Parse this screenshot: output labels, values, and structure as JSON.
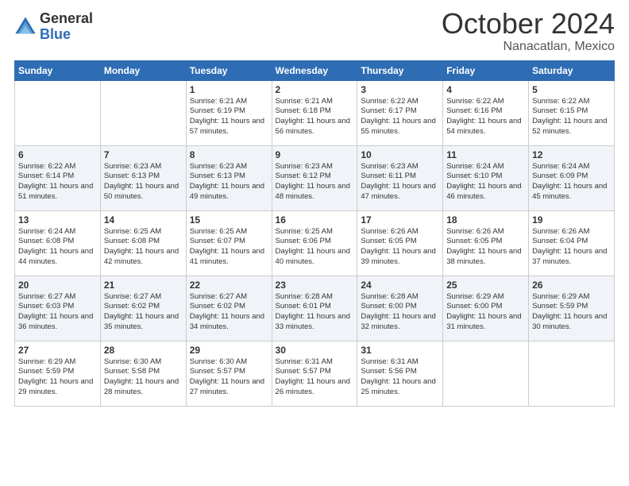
{
  "logo": {
    "general": "General",
    "blue": "Blue"
  },
  "title": {
    "month": "October 2024",
    "location": "Nanacatlan, Mexico"
  },
  "days_of_week": [
    "Sunday",
    "Monday",
    "Tuesday",
    "Wednesday",
    "Thursday",
    "Friday",
    "Saturday"
  ],
  "weeks": [
    [
      {
        "day": "",
        "info": ""
      },
      {
        "day": "",
        "info": ""
      },
      {
        "day": "1",
        "info": "Sunrise: 6:21 AM\nSunset: 6:19 PM\nDaylight: 11 hours and 57 minutes."
      },
      {
        "day": "2",
        "info": "Sunrise: 6:21 AM\nSunset: 6:18 PM\nDaylight: 11 hours and 56 minutes."
      },
      {
        "day": "3",
        "info": "Sunrise: 6:22 AM\nSunset: 6:17 PM\nDaylight: 11 hours and 55 minutes."
      },
      {
        "day": "4",
        "info": "Sunrise: 6:22 AM\nSunset: 6:16 PM\nDaylight: 11 hours and 54 minutes."
      },
      {
        "day": "5",
        "info": "Sunrise: 6:22 AM\nSunset: 6:15 PM\nDaylight: 11 hours and 52 minutes."
      }
    ],
    [
      {
        "day": "6",
        "info": "Sunrise: 6:22 AM\nSunset: 6:14 PM\nDaylight: 11 hours and 51 minutes."
      },
      {
        "day": "7",
        "info": "Sunrise: 6:23 AM\nSunset: 6:13 PM\nDaylight: 11 hours and 50 minutes."
      },
      {
        "day": "8",
        "info": "Sunrise: 6:23 AM\nSunset: 6:13 PM\nDaylight: 11 hours and 49 minutes."
      },
      {
        "day": "9",
        "info": "Sunrise: 6:23 AM\nSunset: 6:12 PM\nDaylight: 11 hours and 48 minutes."
      },
      {
        "day": "10",
        "info": "Sunrise: 6:23 AM\nSunset: 6:11 PM\nDaylight: 11 hours and 47 minutes."
      },
      {
        "day": "11",
        "info": "Sunrise: 6:24 AM\nSunset: 6:10 PM\nDaylight: 11 hours and 46 minutes."
      },
      {
        "day": "12",
        "info": "Sunrise: 6:24 AM\nSunset: 6:09 PM\nDaylight: 11 hours and 45 minutes."
      }
    ],
    [
      {
        "day": "13",
        "info": "Sunrise: 6:24 AM\nSunset: 6:08 PM\nDaylight: 11 hours and 44 minutes."
      },
      {
        "day": "14",
        "info": "Sunrise: 6:25 AM\nSunset: 6:08 PM\nDaylight: 11 hours and 42 minutes."
      },
      {
        "day": "15",
        "info": "Sunrise: 6:25 AM\nSunset: 6:07 PM\nDaylight: 11 hours and 41 minutes."
      },
      {
        "day": "16",
        "info": "Sunrise: 6:25 AM\nSunset: 6:06 PM\nDaylight: 11 hours and 40 minutes."
      },
      {
        "day": "17",
        "info": "Sunrise: 6:26 AM\nSunset: 6:05 PM\nDaylight: 11 hours and 39 minutes."
      },
      {
        "day": "18",
        "info": "Sunrise: 6:26 AM\nSunset: 6:05 PM\nDaylight: 11 hours and 38 minutes."
      },
      {
        "day": "19",
        "info": "Sunrise: 6:26 AM\nSunset: 6:04 PM\nDaylight: 11 hours and 37 minutes."
      }
    ],
    [
      {
        "day": "20",
        "info": "Sunrise: 6:27 AM\nSunset: 6:03 PM\nDaylight: 11 hours and 36 minutes."
      },
      {
        "day": "21",
        "info": "Sunrise: 6:27 AM\nSunset: 6:02 PM\nDaylight: 11 hours and 35 minutes."
      },
      {
        "day": "22",
        "info": "Sunrise: 6:27 AM\nSunset: 6:02 PM\nDaylight: 11 hours and 34 minutes."
      },
      {
        "day": "23",
        "info": "Sunrise: 6:28 AM\nSunset: 6:01 PM\nDaylight: 11 hours and 33 minutes."
      },
      {
        "day": "24",
        "info": "Sunrise: 6:28 AM\nSunset: 6:00 PM\nDaylight: 11 hours and 32 minutes."
      },
      {
        "day": "25",
        "info": "Sunrise: 6:29 AM\nSunset: 6:00 PM\nDaylight: 11 hours and 31 minutes."
      },
      {
        "day": "26",
        "info": "Sunrise: 6:29 AM\nSunset: 5:59 PM\nDaylight: 11 hours and 30 minutes."
      }
    ],
    [
      {
        "day": "27",
        "info": "Sunrise: 6:29 AM\nSunset: 5:59 PM\nDaylight: 11 hours and 29 minutes."
      },
      {
        "day": "28",
        "info": "Sunrise: 6:30 AM\nSunset: 5:58 PM\nDaylight: 11 hours and 28 minutes."
      },
      {
        "day": "29",
        "info": "Sunrise: 6:30 AM\nSunset: 5:57 PM\nDaylight: 11 hours and 27 minutes."
      },
      {
        "day": "30",
        "info": "Sunrise: 6:31 AM\nSunset: 5:57 PM\nDaylight: 11 hours and 26 minutes."
      },
      {
        "day": "31",
        "info": "Sunrise: 6:31 AM\nSunset: 5:56 PM\nDaylight: 11 hours and 25 minutes."
      },
      {
        "day": "",
        "info": ""
      },
      {
        "day": "",
        "info": ""
      }
    ]
  ]
}
